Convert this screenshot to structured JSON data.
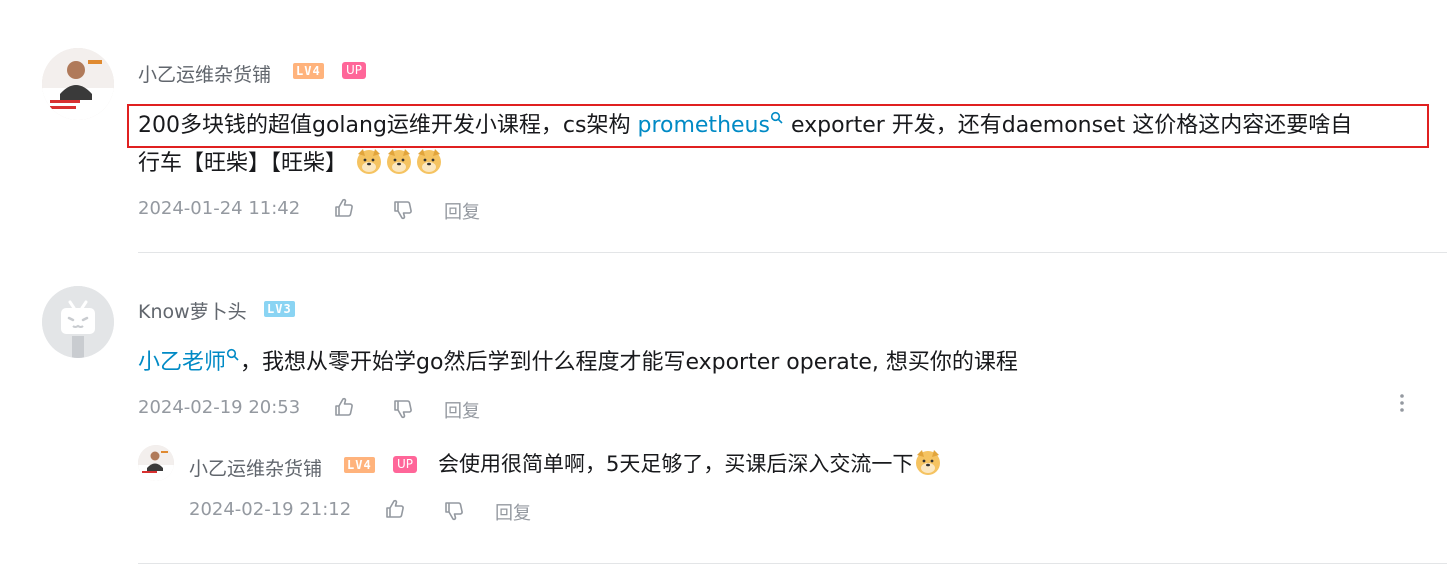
{
  "comments": [
    {
      "username": "小乙运维杂货铺",
      "level": "LV4",
      "up_badge": "UP",
      "text_1": "200多块钱的超值golang运维开发小课程，cs架构 ",
      "link": "prometheus",
      "text_2": " exporter 开发，还有daemonset  这价格这内容还要啥自",
      "text_3": "行车【旺柴】【旺柴】",
      "time": "2024-01-24 11:42",
      "reply_label": "回复"
    },
    {
      "username": "Know萝卜头",
      "level": "LV3",
      "mention": "小乙老师",
      "text": "，我想从零开始学go然后学到什么程度才能写exporter operate, 想买你的课程",
      "time": "2024-02-19 20:53",
      "reply_label": "回复",
      "replies": [
        {
          "username": "小乙运维杂货铺",
          "level": "LV4",
          "up_badge": "UP",
          "text": "会使用很简单啊，5天足够了，买课后深入交流一下",
          "time": "2024-02-19 21:12",
          "reply_label": "回复"
        }
      ]
    }
  ],
  "colors": {
    "link": "#008ac5",
    "highlight": "#e02020",
    "up_badge": "#ff6699",
    "lv4": "#ffb37c",
    "lv3": "#8ad4f3"
  },
  "icons": [
    "like-icon",
    "dislike-icon",
    "search-icon",
    "doge-emoji",
    "more-icon",
    "tv-avatar-icon"
  ]
}
